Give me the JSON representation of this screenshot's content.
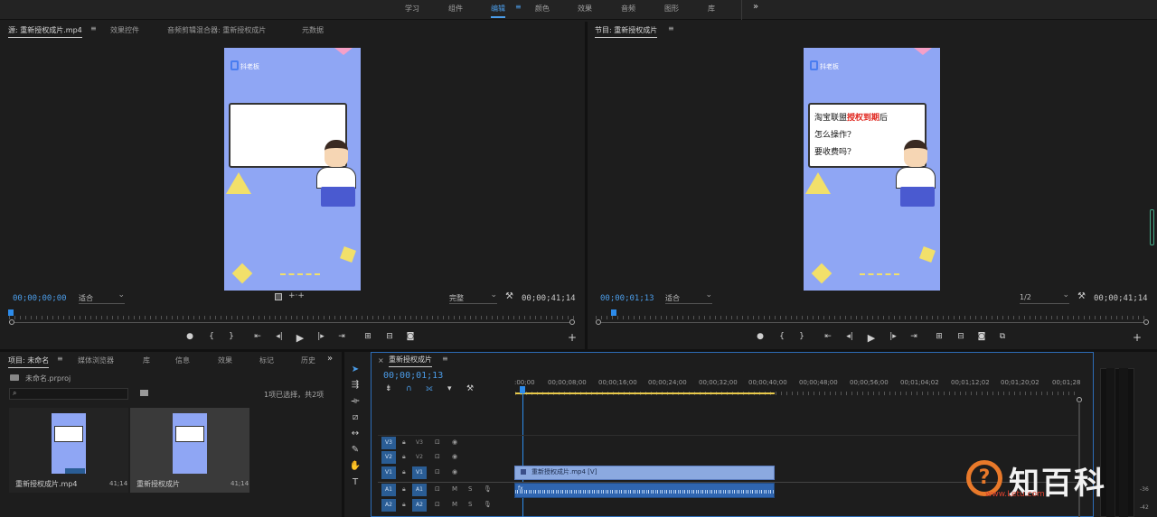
{
  "workspaces": {
    "items": [
      "学习",
      "组件",
      "编辑",
      "颜色",
      "效果",
      "音频",
      "图形",
      "库"
    ],
    "active_index": 2,
    "more": "»"
  },
  "source_monitor": {
    "tabs": [
      "源: 重新授权成片.mp4",
      "效果控件",
      "音频剪辑混合器: 重新授权成片",
      "元数据"
    ],
    "timecode": "00;00;00;00",
    "fit": "适合",
    "quality": "完整",
    "duration": "00;00;41;14",
    "logo_text": "抖老板"
  },
  "program_monitor": {
    "tab": "节目: 重新授权成片",
    "timecode": "00;00;01;13",
    "fit": "适合",
    "quality": "1/2",
    "duration": "00;00;41;14",
    "logo_text": "抖老板",
    "caption_line1_a": "淘宝联盟",
    "caption_line1_b": "授权到期",
    "caption_line1_c": "后",
    "caption_line2": "怎么操作?",
    "caption_line3": "要收费吗?"
  },
  "project_panel": {
    "tabs": [
      "项目: 未命名",
      "媒体浏览器",
      "库",
      "信息",
      "效果",
      "标记",
      "历史"
    ],
    "project_file": "未命名.prproj",
    "selection_info": "1项已选择，共2项",
    "items": [
      {
        "name": "重新授权成片.mp4",
        "duration": "41;14"
      },
      {
        "name": "重新授权成片",
        "duration": "41;14"
      }
    ]
  },
  "timeline": {
    "sequence_name": "重新授权成片",
    "timecode": "00;00;01;13",
    "ruler_labels": [
      ":00;00",
      "00;00;08;00",
      "00;00;16;00",
      "00;00;24;00",
      "00;00;32;00",
      "00;00;40;00",
      "00;00;48;00",
      "00;00;56;00",
      "00;01;04;02",
      "00;01;12;02",
      "00;01;20;02",
      "00;01;28"
    ],
    "video_tracks": [
      {
        "target": "V3",
        "name": "V3"
      },
      {
        "target": "V2",
        "name": "V2"
      },
      {
        "target": "V1",
        "name": "V1"
      }
    ],
    "audio_tracks": [
      {
        "target": "A1",
        "name": "A1",
        "m": "M",
        "s": "S"
      },
      {
        "target": "A2",
        "name": "A2",
        "m": "M",
        "s": "S"
      }
    ],
    "video_clip_label": "重新授权成片.mp4 [V]",
    "audio_clip_label": "fx"
  },
  "meter": {
    "labels": [
      "-36",
      "-42"
    ]
  },
  "watermark": {
    "main": "知百科",
    "sub": "www.Letu.com"
  },
  "colors": {
    "accent": "#4b9ce8",
    "video_bg": "#8fa6f4",
    "track_target": "#2a5d95"
  }
}
